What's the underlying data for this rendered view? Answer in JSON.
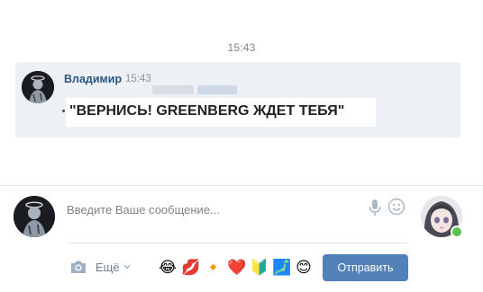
{
  "feed": {
    "time_divider": "15:43"
  },
  "message": {
    "author": "Владимир",
    "time": "15:43",
    "text": "\"ВЕРНИСЬ! GREENBERG ЖДЕТ ТЕБЯ\""
  },
  "composer": {
    "placeholder": "Введите Ваше сообщение...",
    "more_label": "Ещё",
    "send_label": "Отправить",
    "emojis": [
      "😂",
      "💋",
      "🔸",
      "❤️",
      "🔰",
      "🗾",
      "😊"
    ]
  },
  "icons": {
    "attach": "camera-icon",
    "voice": "microphone-icon",
    "emoji_picker": "smile-icon",
    "more": "chevron-down-icon"
  },
  "colors": {
    "author_link": "#2a5885",
    "message_bg": "#edf0f5",
    "send_button": "#5181b8",
    "online": "#5bc24f"
  }
}
